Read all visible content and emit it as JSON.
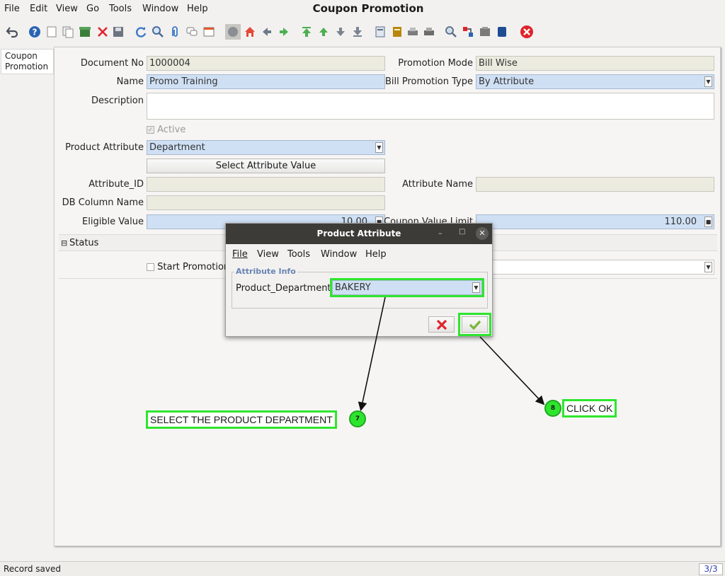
{
  "window": {
    "title": "Coupon Promotion"
  },
  "menu": {
    "file": "File",
    "edit": "Edit",
    "view": "View",
    "go": "Go",
    "tools": "Tools",
    "window": "Window",
    "help": "Help"
  },
  "left_tab": {
    "label": "Coupon Promotion"
  },
  "form": {
    "document_no_label": "Document No",
    "document_no_value": "1000004",
    "promotion_mode_label": "Promotion Mode",
    "promotion_mode_value": "Bill Wise",
    "name_label": "Name",
    "name_value": "Promo Training",
    "bill_promotion_type_label": "Bill Promotion Type",
    "bill_promotion_type_value": "By Attribute",
    "description_label": "Description",
    "description_value": "",
    "active_label": "Active",
    "product_attribute_label": "Product Attribute",
    "product_attribute_value": "Department",
    "select_attribute_button": "Select Attribute Value",
    "attribute_id_label": "Attribute_ID",
    "attribute_name_label": "Attribute Name",
    "db_column_name_label": "DB Column Name",
    "eligible_value_label": "Eligible Value",
    "eligible_value_value": "10.00",
    "coupon_value_limit_label": "Coupon Value Limit",
    "coupon_value_limit_value": "110.00",
    "status_section": "Status",
    "start_promotion_label": "Start Promotion"
  },
  "dialog": {
    "title": "Product Attribute",
    "menu": {
      "file": "File",
      "view": "View",
      "tools": "Tools",
      "window": "Window",
      "help": "Help"
    },
    "group_label": "Attribute Info",
    "field_label": "Product_Department",
    "field_value": "BAKERY"
  },
  "annotations": {
    "step7_number": "7",
    "step7_text": "SELECT THE PRODUCT DEPARTMENT",
    "step8_number": "8",
    "step8_text": "CLICK OK"
  },
  "status": {
    "message": "Record saved",
    "record_counter": "3/3"
  },
  "colors": {
    "annotation_green": "#2ee52e",
    "field_blue": "#cfe0f4",
    "readonly_field": "#ecebdf"
  }
}
